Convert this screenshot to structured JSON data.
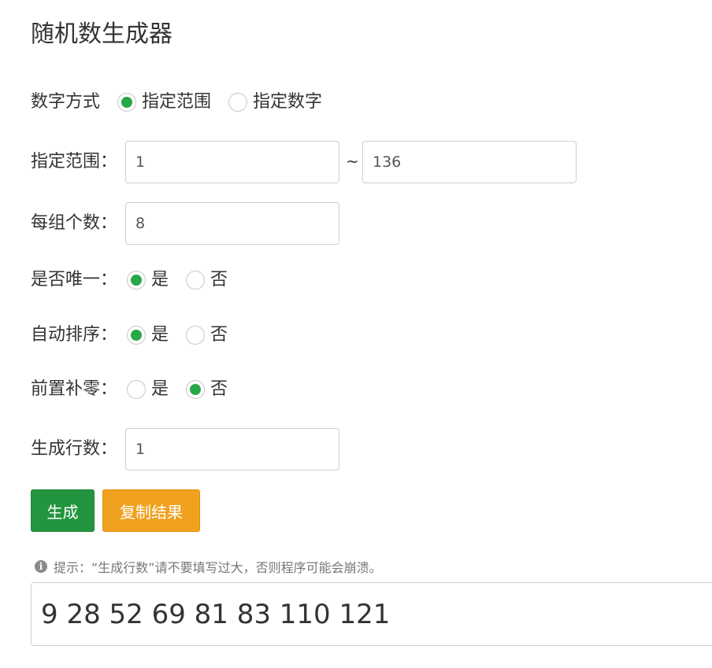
{
  "title": "随机数生成器",
  "mode": {
    "label": "数字方式",
    "options": [
      {
        "label": "指定范围",
        "checked": true
      },
      {
        "label": "指定数字",
        "checked": false
      }
    ]
  },
  "range": {
    "label": "指定范围：",
    "min_value": "1",
    "separator": "~",
    "max_value": "136"
  },
  "group_count": {
    "label": "每组个数：",
    "value": "8"
  },
  "unique": {
    "label": "是否唯一：",
    "yes_label": "是",
    "no_label": "否",
    "selected": "是"
  },
  "auto_sort": {
    "label": "自动排序：",
    "yes_label": "是",
    "no_label": "否",
    "selected": "是"
  },
  "zero_pad": {
    "label": "前置补零：",
    "yes_label": "是",
    "no_label": "否",
    "selected": "否"
  },
  "rows": {
    "label": "生成行数：",
    "value": "1"
  },
  "buttons": {
    "generate": "生成",
    "copy": "复制结果"
  },
  "tip": {
    "icon": "info-circle-icon",
    "text": "提示：“生成行数”请不要填写过大，否则程序可能会崩溃。"
  },
  "result": "9 28 52 69 81 83 110 121",
  "colors": {
    "radio_checked": "#28a745",
    "generate_button": "#23953f",
    "copy_button": "#f0a11f"
  }
}
